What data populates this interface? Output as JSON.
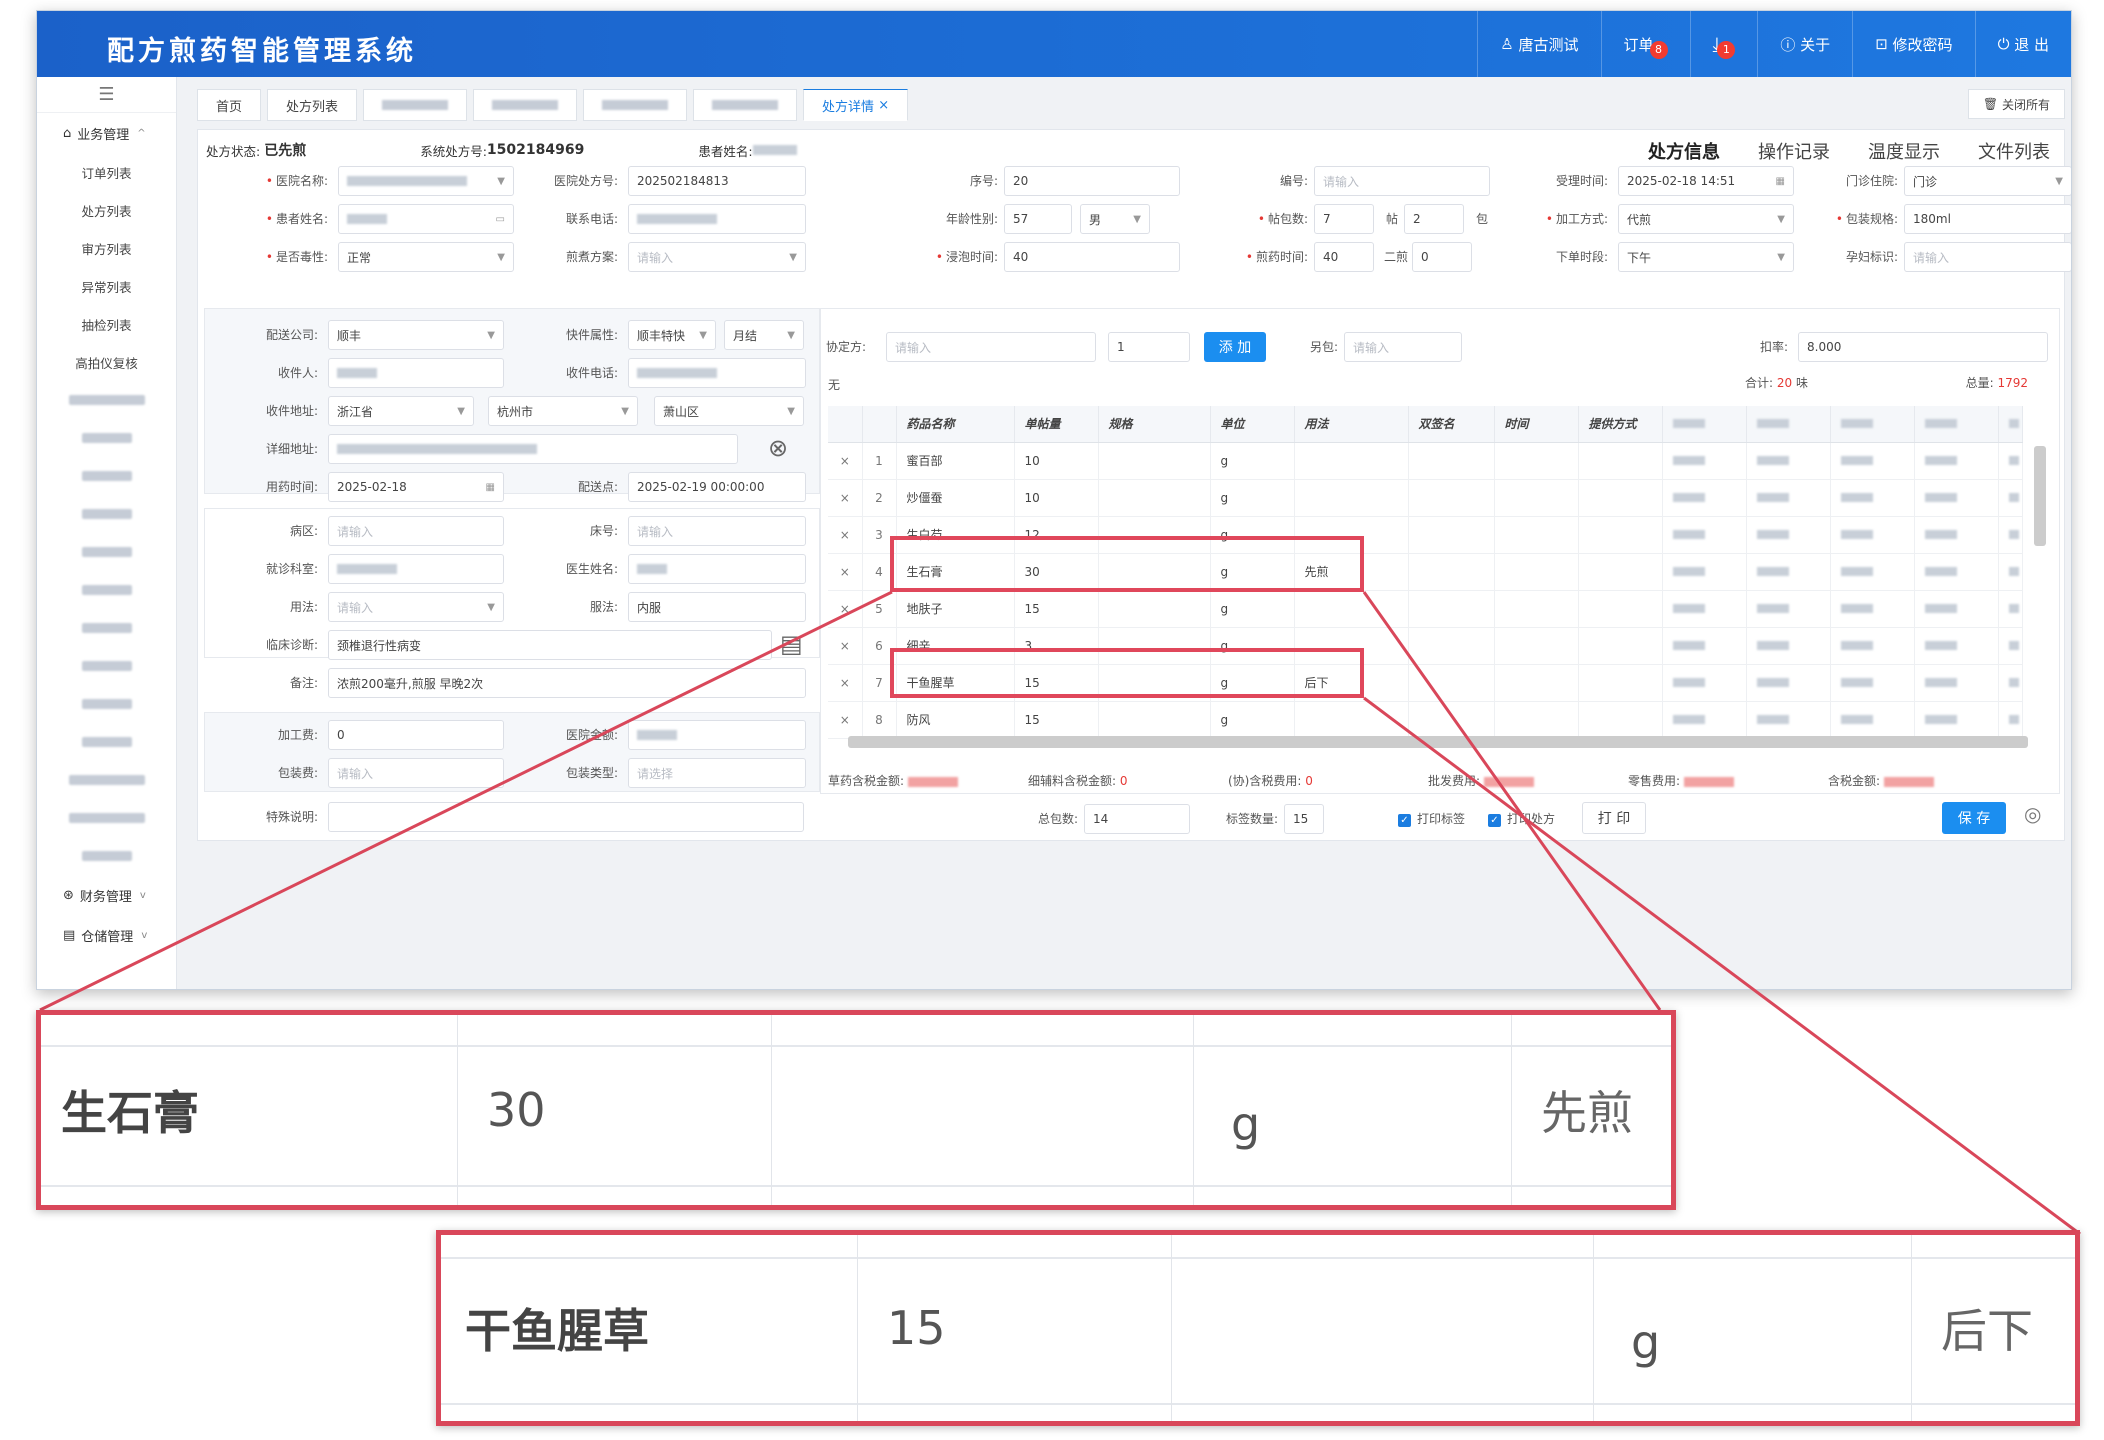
{
  "app": {
    "title": "配方煎药智能管理系统"
  },
  "topnav": [
    {
      "icon": "user-icon",
      "glyph": "♙",
      "label": "唐古测试",
      "badge": ""
    },
    {
      "icon": "order-icon",
      "glyph": "",
      "label": "订单",
      "badge": "8"
    },
    {
      "icon": "download-icon",
      "glyph": "⤓",
      "label": "",
      "badge": "1"
    },
    {
      "icon": "info-icon",
      "glyph": "ⓘ",
      "label": "关于",
      "badge": ""
    },
    {
      "icon": "lock-icon",
      "glyph": "⊡",
      "label": "修改密码",
      "badge": ""
    },
    {
      "icon": "logout-icon",
      "glyph": "⏻",
      "label": "退 出",
      "badge": ""
    }
  ],
  "sidebar": {
    "group1": "业务管理",
    "items": [
      "订单列表",
      "处方列表",
      "审方列表",
      "异常列表",
      "抽检列表",
      "高拍仪复核"
    ],
    "group2": "财务管理",
    "group3": "仓储管理"
  },
  "tabs": {
    "home": "首页",
    "list": "处方列表",
    "detail": "处方详情",
    "close_all": "关闭所有"
  },
  "status": {
    "label": "处方状态:",
    "value": "已先煎",
    "sysno_label": "系统处方号:",
    "sysno": "1502184969",
    "patient_label": "患者姓名:"
  },
  "right_tabs": [
    "处方信息",
    "操作记录",
    "温度显示",
    "文件列表"
  ],
  "form": {
    "hospital_label": "医院名称:",
    "hosp_no_label": "医院处方号:",
    "hosp_no": "202502184813",
    "seq_label": "序号:",
    "seq": "20",
    "code_label": "编号:",
    "code_ph": "请输入",
    "recv_time_label": "受理时间:",
    "recv_time": "2025-02-18 14:51",
    "clinic_label": "门诊住院:",
    "clinic": "门诊",
    "patient_label": "患者姓名:",
    "phone_label": "联系电话:",
    "age_label": "年龄性别:",
    "age": "57",
    "sex": "男",
    "packs_label": "帖包数:",
    "packs": "7",
    "tie": "帖",
    "packs2": "2",
    "bao": "包",
    "method_label": "加工方式:",
    "method": "代煎",
    "spec_label": "包装规格:",
    "spec": "180ml",
    "toxic_label": "是否毒性:",
    "toxic": "正常",
    "plan_label": "煎煮方案:",
    "plan_ph": "请输入",
    "soak_label": "浸泡时间:",
    "soak": "40",
    "boil_label": "煎药时间:",
    "boil": "40",
    "second_label": "二煎",
    "second": "0",
    "order_time_label": "下单时段:",
    "order_time": "下午",
    "preg_label": "孕妇标识:",
    "preg_ph": "请输入"
  },
  "delivery": {
    "company_label": "配送公司:",
    "company": "顺丰",
    "express_label": "快件属性:",
    "express": "顺丰特快",
    "settle": "月结",
    "receiver_label": "收件人:",
    "recv_phone_label": "收件电话:",
    "addr_label": "收件地址:",
    "province": "浙江省",
    "city": "杭州市",
    "district": "萧山区",
    "detail_label": "详细地址:",
    "use_date_label": "用药时间:",
    "use_date": "2025-02-18",
    "deliver_label": "配送点:",
    "deliver": "2025-02-19 00:00:00"
  },
  "clinical": {
    "ward_label": "病区:",
    "ward_ph": "请输入",
    "bed_label": "床号:",
    "bed_ph": "请输入",
    "dept_label": "就诊科室:",
    "doctor_label": "医生姓名:",
    "usage_label": "用法:",
    "usage_ph": "请输入",
    "take_label": "服法:",
    "take": "内服",
    "diag_label": "临床诊断:",
    "diag": "颈椎退行性病变",
    "note_label": "备注:",
    "note": "浓煎200毫升,煎服 早晚2次"
  },
  "fees": {
    "proc_label": "加工费:",
    "proc": "0",
    "hosp_amt_label": "医院金额:",
    "pack_fee_label": "包装费:",
    "pack_fee_ph": "请输入",
    "pack_type_label": "包装类型:",
    "pack_type_ph": "请选择",
    "special_label": "特殊说明:"
  },
  "herb_ctrl": {
    "xie_label": "协定方:",
    "xie_ph": "请输入",
    "qty": "1",
    "add": "添 加",
    "other_label": "另包:",
    "other_ph": "请输入",
    "discount_label": "扣率:",
    "discount": "8.000",
    "none": "无",
    "total_label": "合计:",
    "total": "20",
    "wei": "味",
    "weight_label": "总量:",
    "weight": "1792"
  },
  "grid": {
    "headers": [
      "药品名称",
      "单帖量",
      "规格",
      "单位",
      "用法",
      "双签名",
      "时间",
      "提供方式"
    ],
    "rows": [
      {
        "no": "1",
        "name": "蜜百部",
        "dose": "10",
        "unit": "g",
        "usage": ""
      },
      {
        "no": "2",
        "name": "炒僵蚕",
        "dose": "10",
        "unit": "g",
        "usage": ""
      },
      {
        "no": "3",
        "name": "生白芍",
        "dose": "12",
        "unit": "g",
        "usage": ""
      },
      {
        "no": "4",
        "name": "生石膏",
        "dose": "30",
        "unit": "g",
        "usage": "先煎"
      },
      {
        "no": "5",
        "name": "地肤子",
        "dose": "15",
        "unit": "g",
        "usage": ""
      },
      {
        "no": "6",
        "name": "细辛",
        "dose": "3",
        "unit": "g",
        "usage": ""
      },
      {
        "no": "7",
        "name": "干鱼腥草",
        "dose": "15",
        "unit": "g",
        "usage": "后下"
      },
      {
        "no": "8",
        "name": "防风",
        "dose": "15",
        "unit": "g",
        "usage": ""
      }
    ]
  },
  "summary": {
    "herb_amt": "草药含税金额:",
    "granule_amt": "细辅料含税金额:",
    "granule_val": "0",
    "xie_amt": "(协)含税费用:",
    "xie_val": "0",
    "wholesale": "批发费用:",
    "retail": "零售费用:",
    "tax_amt": "含税金额:"
  },
  "bottom": {
    "total_packs_label": "总包数:",
    "total_packs": "14",
    "labels_label": "标签数量:",
    "labels": "15",
    "print_label": "打印标签",
    "print_rx": "打印处方",
    "print_btn": "打 印",
    "save": "保 存"
  },
  "zoom1": {
    "name": "生石膏",
    "dose": "30",
    "unit": "g",
    "usage": "先煎"
  },
  "zoom2": {
    "name": "干鱼腥草",
    "dose": "15",
    "unit": "g",
    "usage": "后下"
  },
  "colors": {
    "primary": "#1b61c9",
    "accent": "#1b8ef0",
    "highlight": "#e0475b",
    "required": "#e53935"
  }
}
